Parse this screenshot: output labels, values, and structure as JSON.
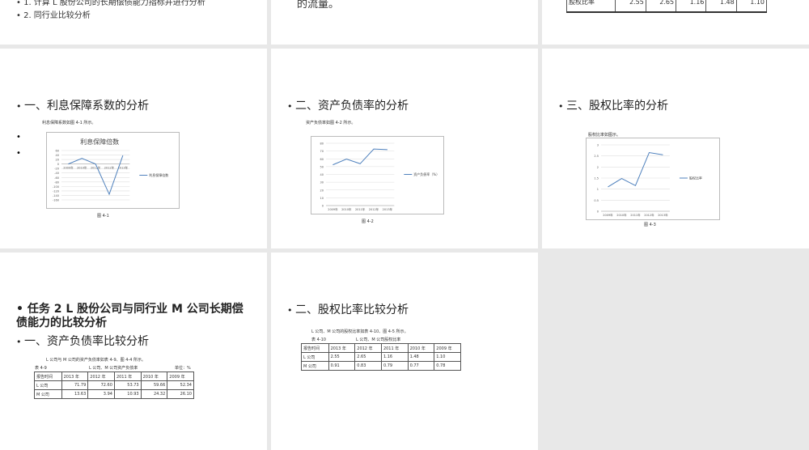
{
  "slides": [
    {
      "bullets": [
        "1. 计算 L 股份公司的长期偿债能力指标并进行分析",
        "2. 同行业比较分析"
      ]
    },
    {
      "text": "的流量。"
    },
    {
      "table_row": [
        "股权比率",
        "2.55",
        "2.65",
        "1.16",
        "1.48",
        "1.10"
      ]
    },
    {
      "heading": "一、利息保障系数的分析",
      "caption": "利息保障系数如图 4-1 所示。",
      "figure": "图 4-1"
    },
    {
      "heading": "二、资产负债率的分析",
      "caption": "资产负债率如图 4-2 所示。",
      "figure": "图 4-2"
    },
    {
      "heading": "三、股权比率的分析",
      "caption": "股权比率如图示。",
      "figure": "图 4-3"
    },
    {
      "heading": "任务 2 L 股份公司与同行业 M 公司长期偿债能力的比较分析",
      "sub": "一、资产负债率比较分析",
      "caption": "L 公司与 M 公司的资产负债率如表 4-9、图 4-4 所示。",
      "table_no": "表 4-9",
      "table_title": "L 公司、M 公司资产负债率",
      "unit": "单位：%",
      "table": [
        [
          "报告时间",
          "2013 年",
          "2012 年",
          "2011 年",
          "2010 年",
          "2009 年"
        ],
        [
          "L 公司",
          "71.79",
          "72.60",
          "53.73",
          "59.66",
          "52.34"
        ],
        [
          "M 公司",
          "13.63",
          "3.94",
          "10.93",
          "24.32",
          "26.10"
        ]
      ]
    },
    {
      "heading": "二、股权比率比较分析",
      "caption": "L 公司、M 公司的股权比率如表 4-10、图 4-5 所示。",
      "table_no": "表 4-10",
      "table_title": "L 公司、M 公司股权比率",
      "table": [
        [
          "报告时间",
          "2013 年",
          "2012 年",
          "2011 年",
          "2010 年",
          "2009 年"
        ],
        [
          "L 公司",
          "2.55",
          "2.65",
          "1.16",
          "1.48",
          "1.10"
        ],
        [
          "M 公司",
          "0.91",
          "0.83",
          "0.79",
          "0.77",
          "0.78"
        ]
      ]
    }
  ],
  "chart_data": [
    {
      "type": "line",
      "title": "利息保障倍数",
      "categories": [
        "2009年",
        "2010年",
        "2011年",
        "2012年",
        "2013年"
      ],
      "series": [
        {
          "name": "利息保障倍数",
          "values": [
            0,
            25,
            0,
            -135,
            38
          ]
        }
      ],
      "ylim": [
        -160,
        60
      ],
      "ystep": 20,
      "legend": "right",
      "grid": true,
      "color": "#4f81bd"
    },
    {
      "type": "line",
      "title": "",
      "categories": [
        "2009年",
        "2010年",
        "2011年",
        "2012年",
        "2013年"
      ],
      "series": [
        {
          "name": "资产负债率（%）",
          "values": [
            52.34,
            59.66,
            53.73,
            72.6,
            71.79
          ]
        }
      ],
      "ylim": [
        0,
        80
      ],
      "ystep": 10,
      "legend": "right",
      "grid": true,
      "color": "#4f81bd"
    },
    {
      "type": "line",
      "title": "",
      "categories": [
        "2009年",
        "2010年",
        "2011年",
        "2012年",
        "2013年"
      ],
      "series": [
        {
          "name": "股权比率",
          "values": [
            1.1,
            1.48,
            1.16,
            2.65,
            2.55
          ]
        }
      ],
      "ylim": [
        0,
        3
      ],
      "ystep": 0.5,
      "legend": "right",
      "grid": true,
      "color": "#4f81bd"
    }
  ]
}
